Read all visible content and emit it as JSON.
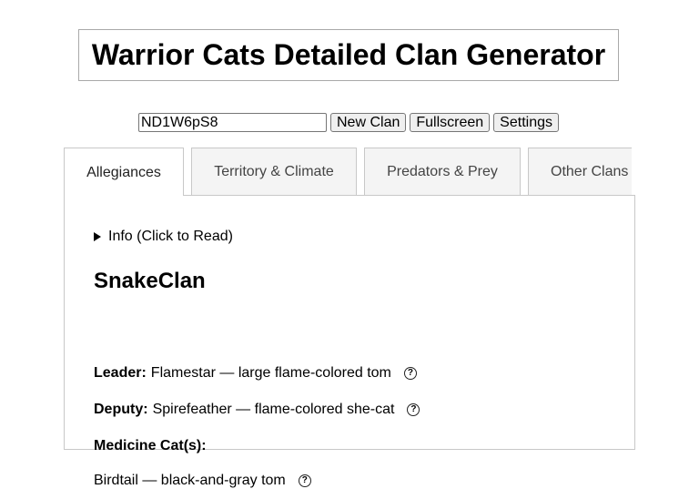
{
  "header": {
    "title": "Warrior Cats Detailed Clan Generator"
  },
  "controls": {
    "seed_value": "ND1W6pS8",
    "new_clan_label": "New Clan",
    "fullscreen_label": "Fullscreen",
    "settings_label": "Settings"
  },
  "tabs": [
    {
      "label": "Allegiances",
      "active": true
    },
    {
      "label": "Territory & Climate",
      "active": false
    },
    {
      "label": "Predators & Prey",
      "active": false
    },
    {
      "label": "Other Clans",
      "active": false
    }
  ],
  "panel": {
    "info_summary": "Info (Click to Read)",
    "clan_name": "SnakeClan",
    "leader": {
      "label": "Leader:",
      "value": "Flamestar — large flame-colored tom"
    },
    "deputy": {
      "label": "Deputy:",
      "value": "Spirefeather — flame-colored she-cat"
    },
    "medicine_heading": "Medicine Cat(s):",
    "medicine_cats": [
      {
        "value": "Birdtail — black-and-gray tom"
      }
    ]
  },
  "icons": {
    "help": "help-circle-icon",
    "disclosure": "disclosure-triangle-icon"
  }
}
